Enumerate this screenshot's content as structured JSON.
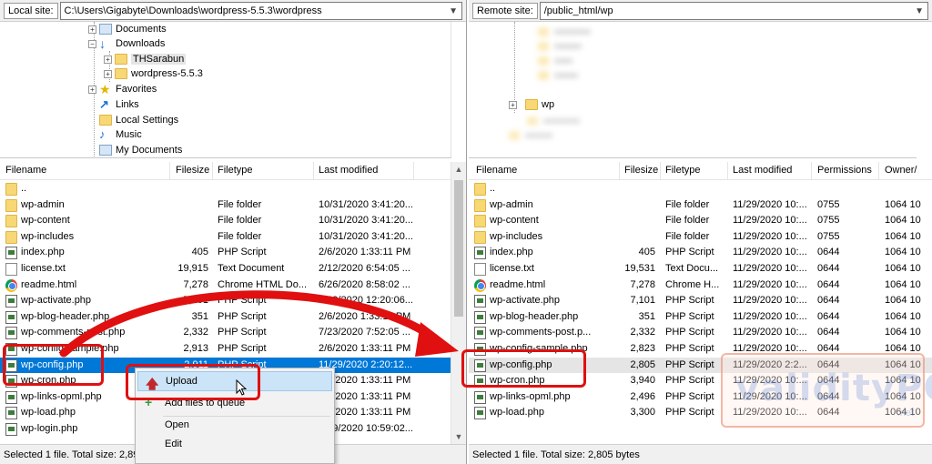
{
  "local": {
    "site_label": "Local site:",
    "site_path": "C:\\Users\\Gigabyte\\Downloads\\wordpress-5.5.3\\wordpress",
    "tree": [
      {
        "label": "Documents",
        "icon": "documents-folder-icon"
      },
      {
        "label": "Downloads",
        "icon": "downloads-arrow-icon"
      },
      {
        "label": "THSarabun",
        "icon": "folder-icon",
        "selected": true
      },
      {
        "label": "wordpress-5.5.3",
        "icon": "folder-icon"
      },
      {
        "label": "Favorites",
        "icon": "star-icon"
      },
      {
        "label": "Links",
        "icon": "links-arrow-icon"
      },
      {
        "label": "Local Settings",
        "icon": "folder-icon"
      },
      {
        "label": "Music",
        "icon": "music-note-icon"
      },
      {
        "label": "My Documents",
        "icon": "documents-folder-icon"
      }
    ],
    "columns": [
      "Filename",
      "Filesize",
      "Filetype",
      "Last modified"
    ],
    "files": [
      {
        "name": "..",
        "size": "",
        "type": "",
        "modified": "",
        "icon": "folder"
      },
      {
        "name": "wp-admin",
        "size": "",
        "type": "File folder",
        "modified": "10/31/2020 3:41:20...",
        "icon": "folder"
      },
      {
        "name": "wp-content",
        "size": "",
        "type": "File folder",
        "modified": "10/31/2020 3:41:20...",
        "icon": "folder"
      },
      {
        "name": "wp-includes",
        "size": "",
        "type": "File folder",
        "modified": "10/31/2020 3:41:20...",
        "icon": "folder"
      },
      {
        "name": "index.php",
        "size": "405",
        "type": "PHP Script",
        "modified": "2/6/2020 1:33:11 PM",
        "icon": "php"
      },
      {
        "name": "license.txt",
        "size": "19,915",
        "type": "Text Document",
        "modified": "2/12/2020 6:54:05 ...",
        "icon": "doc"
      },
      {
        "name": "readme.html",
        "size": "7,278",
        "type": "Chrome HTML Do...",
        "modified": "6/26/2020 8:58:02 ...",
        "icon": "chrome"
      },
      {
        "name": "wp-activate.php",
        "size": "7,101",
        "type": "PHP Script",
        "modified": "7/29/2020 12:20:06...",
        "icon": "php"
      },
      {
        "name": "wp-blog-header.php",
        "size": "351",
        "type": "PHP Script",
        "modified": "2/6/2020 1:33:11 PM",
        "icon": "php"
      },
      {
        "name": "wp-comments-post.php",
        "size": "2,332",
        "type": "PHP Script",
        "modified": "7/23/2020 7:52:05 ...",
        "icon": "php"
      },
      {
        "name": "wp-config-sample.php",
        "size": "2,913",
        "type": "PHP Script",
        "modified": "2/6/2020 1:33:11 PM",
        "icon": "php"
      },
      {
        "name": "wp-config.php",
        "size": "2,911",
        "type": "PHP Script",
        "modified": "11/29/2020 2:20:12...",
        "icon": "php",
        "selected": true
      },
      {
        "name": "wp-cron.php",
        "size": "",
        "type": "",
        "modified": "2/6/2020 1:33:11 PM",
        "icon": "php"
      },
      {
        "name": "wp-links-opml.php",
        "size": "",
        "type": "",
        "modified": "2/6/2020 1:33:11 PM",
        "icon": "php"
      },
      {
        "name": "wp-load.php",
        "size": "",
        "type": "",
        "modified": "2/6/2020 1:33:11 PM",
        "icon": "php"
      },
      {
        "name": "wp-login.php",
        "size": "",
        "type": "",
        "modified": "4/29/2020 10:59:02...",
        "icon": "php"
      }
    ],
    "status": "Selected 1 file. Total size: 2,895"
  },
  "remote": {
    "site_label": "Remote site:",
    "site_path": "/public_html/wp",
    "tree": [
      {
        "label": "wp",
        "icon": "folder-icon"
      }
    ],
    "columns": [
      "Filename",
      "Filesize",
      "Filetype",
      "Last modified",
      "Permissions",
      "Owner/"
    ],
    "files": [
      {
        "name": "..",
        "size": "",
        "type": "",
        "modified": "",
        "perm": "",
        "owner": "",
        "icon": "folder"
      },
      {
        "name": "wp-admin",
        "size": "",
        "type": "File folder",
        "modified": "11/29/2020 10:...",
        "perm": "0755",
        "owner": "1064 10",
        "icon": "folder"
      },
      {
        "name": "wp-content",
        "size": "",
        "type": "File folder",
        "modified": "11/29/2020 10:...",
        "perm": "0755",
        "owner": "1064 10",
        "icon": "folder"
      },
      {
        "name": "wp-includes",
        "size": "",
        "type": "File folder",
        "modified": "11/29/2020 10:...",
        "perm": "0755",
        "owner": "1064 10",
        "icon": "folder"
      },
      {
        "name": "index.php",
        "size": "405",
        "type": "PHP Script",
        "modified": "11/29/2020 10:...",
        "perm": "0644",
        "owner": "1064 10",
        "icon": "php"
      },
      {
        "name": "license.txt",
        "size": "19,531",
        "type": "Text Docu...",
        "modified": "11/29/2020 10:...",
        "perm": "0644",
        "owner": "1064 10",
        "icon": "doc"
      },
      {
        "name": "readme.html",
        "size": "7,278",
        "type": "Chrome H...",
        "modified": "11/29/2020 10:...",
        "perm": "0644",
        "owner": "1064 10",
        "icon": "chrome"
      },
      {
        "name": "wp-activate.php",
        "size": "7,101",
        "type": "PHP Script",
        "modified": "11/29/2020 10:...",
        "perm": "0644",
        "owner": "1064 10",
        "icon": "php"
      },
      {
        "name": "wp-blog-header.php",
        "size": "351",
        "type": "PHP Script",
        "modified": "11/29/2020 10:...",
        "perm": "0644",
        "owner": "1064 10",
        "icon": "php"
      },
      {
        "name": "wp-comments-post.p...",
        "size": "2,332",
        "type": "PHP Script",
        "modified": "11/29/2020 10:...",
        "perm": "0644",
        "owner": "1064 10",
        "icon": "php"
      },
      {
        "name": "wp-config-sample.php",
        "size": "2,823",
        "type": "PHP Script",
        "modified": "11/29/2020 10:...",
        "perm": "0644",
        "owner": "1064 10",
        "icon": "php"
      },
      {
        "name": "wp-config.php",
        "size": "2,805",
        "type": "PHP Script",
        "modified": "11/29/2020 2:2...",
        "perm": "0644",
        "owner": "1064 10",
        "icon": "php",
        "selected": true
      },
      {
        "name": "wp-cron.php",
        "size": "3,940",
        "type": "PHP Script",
        "modified": "11/29/2020 10:...",
        "perm": "0644",
        "owner": "1064 10",
        "icon": "php"
      },
      {
        "name": "wp-links-opml.php",
        "size": "2,496",
        "type": "PHP Script",
        "modified": "11/29/2020 10:...",
        "perm": "0644",
        "owner": "1064 10",
        "icon": "php"
      },
      {
        "name": "wp-load.php",
        "size": "3,300",
        "type": "PHP Script",
        "modified": "11/29/2020 10:...",
        "perm": "0644",
        "owner": "1064 10",
        "icon": "php"
      }
    ],
    "status": "Selected 1 file. Total size: 2,805 bytes"
  },
  "context_menu": {
    "items": [
      {
        "label": "Upload",
        "icon": "upload-arrow-icon",
        "highlighted": true
      },
      {
        "label": "Add files to queue",
        "icon": "add-to-queue-icon"
      },
      {
        "label": "Open",
        "icon": ""
      },
      {
        "label": "Edit",
        "icon": ""
      }
    ]
  },
  "watermark": {
    "text": "validityPC",
    "sub": ".net"
  },
  "colors": {
    "selection": "#0078d7",
    "annotation_red": "#e01010",
    "folder": "#f8d775",
    "menu_highlight": "#cce4f7"
  }
}
